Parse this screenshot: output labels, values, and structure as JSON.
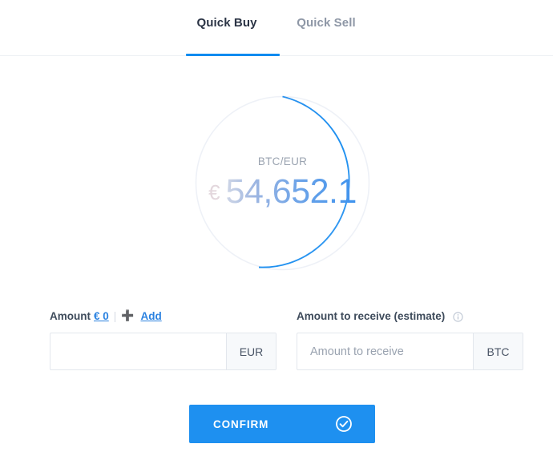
{
  "tabs": [
    {
      "label": "Quick Buy",
      "active": true
    },
    {
      "label": "Quick Sell",
      "active": false
    }
  ],
  "ring": {
    "pair_label": "BTC/EUR",
    "currency_symbol": "€",
    "price": "54,652.1",
    "arc_color": "#1e90f0",
    "track_color": "#eef1f7",
    "progress_percent": 52
  },
  "amount_field": {
    "label": "Amount",
    "balance_link": "€ 0",
    "separator": "|",
    "plus_icon": "plus-icon",
    "add_link": "Add",
    "value": "",
    "placeholder": "",
    "suffix": "EUR"
  },
  "receive_field": {
    "label": "Amount to receive (estimate)",
    "info_icon": "info-circle-icon",
    "value": "",
    "placeholder": "Amount to receive",
    "suffix": "BTC"
  },
  "confirm": {
    "label": "CONFIRM",
    "icon": "check-circle-icon",
    "color": "#1e90f0"
  }
}
